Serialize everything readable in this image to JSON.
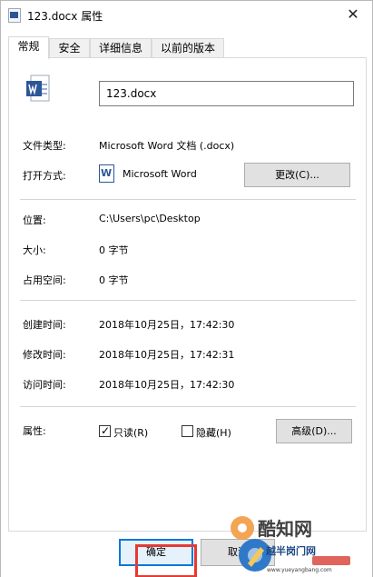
{
  "window": {
    "title": "123.docx 属性",
    "close_symbol": "✕"
  },
  "tabs": [
    {
      "label": "常规"
    },
    {
      "label": "安全"
    },
    {
      "label": "详细信息"
    },
    {
      "label": "以前的版本"
    }
  ],
  "general": {
    "file_name": "123.docx",
    "file_type_label": "文件类型:",
    "file_type_value": "Microsoft Word 文档 (.docx)",
    "open_with_label": "打开方式:",
    "open_with_icon_letter": "W",
    "open_with_value": "Microsoft Word",
    "change_button": "更改(C)...",
    "location_label": "位置:",
    "location_value": "C:\\Users\\pc\\Desktop",
    "size_label": "大小:",
    "size_value": "0 字节",
    "disk_size_label": "占用空间:",
    "disk_size_value": "0 字节",
    "created_label": "创建时间:",
    "created_value": "2018年10月25日，17:42:30",
    "modified_label": "修改时间:",
    "modified_value": "2018年10月25日，17:42:31",
    "accessed_label": "访问时间:",
    "accessed_value": "2018年10月25日，17:42:30",
    "attributes_label": "属性:",
    "readonly_label": "只读(R)",
    "hidden_label": "隐藏(H)",
    "advanced_button": "高级(D)..."
  },
  "buttons": {
    "ok_label": "确定",
    "cancel_label": "取消"
  },
  "watermark": {
    "main": "酷知网",
    "sub": "越半岗门网",
    "url": "www.yueyangbang.com"
  },
  "colors": {
    "accent": "#0078d7",
    "highlight": "#e53935",
    "word_blue": "#2b5797"
  }
}
